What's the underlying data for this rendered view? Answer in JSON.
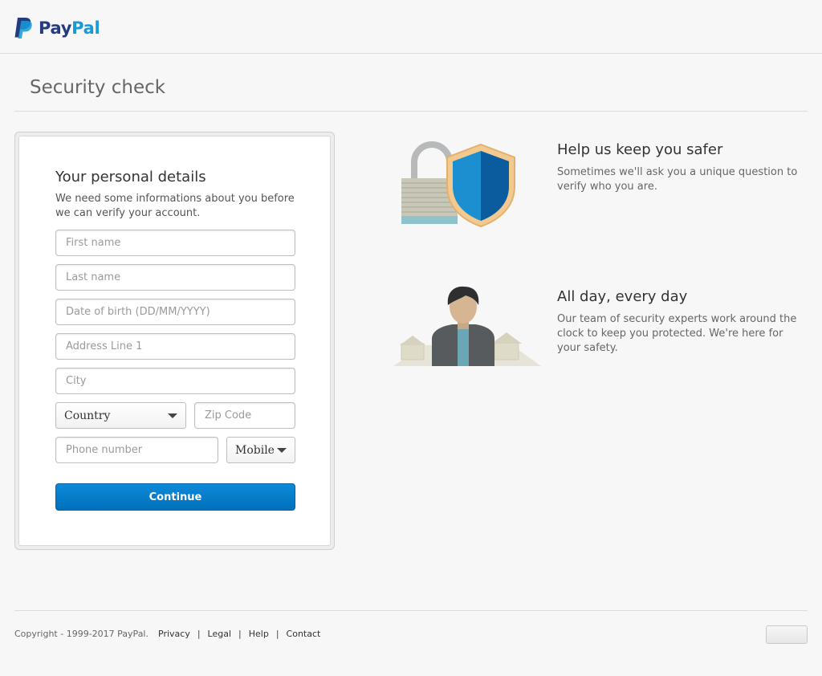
{
  "brand": {
    "word_pay": "Pay",
    "word_pal": "Pal",
    "color_dark": "#253b80",
    "color_light": "#179bd7"
  },
  "page": {
    "title": "Security check"
  },
  "form": {
    "title": "Your personal details",
    "description": "We need some informations about you before we can verify your account.",
    "first_name_placeholder": "First name",
    "last_name_placeholder": "Last name",
    "dob_placeholder": "Date of birth (DD/MM/YYYY)",
    "address_placeholder": "Address Line 1",
    "city_placeholder": "City",
    "country_selected": "Country",
    "zip_placeholder": "Zip Code",
    "phone_placeholder": "Phone number",
    "phone_type_selected": "Mobile",
    "continue_label": "Continue",
    "accent": "#0070ba"
  },
  "info": [
    {
      "title": "Help us keep you safer",
      "text": "Sometimes we'll ask you a unique question to verify who you are.",
      "icon": "lock-shield-icon"
    },
    {
      "title": "All day, every day",
      "text": "Our team of security experts work around the clock to keep you protected. We're here for your safety.",
      "icon": "security-expert-icon"
    }
  ],
  "footer": {
    "copyright": "Copyright - 1999-2017 PayPal.",
    "links": [
      "Privacy",
      "Legal",
      "Help",
      "Contact"
    ]
  }
}
